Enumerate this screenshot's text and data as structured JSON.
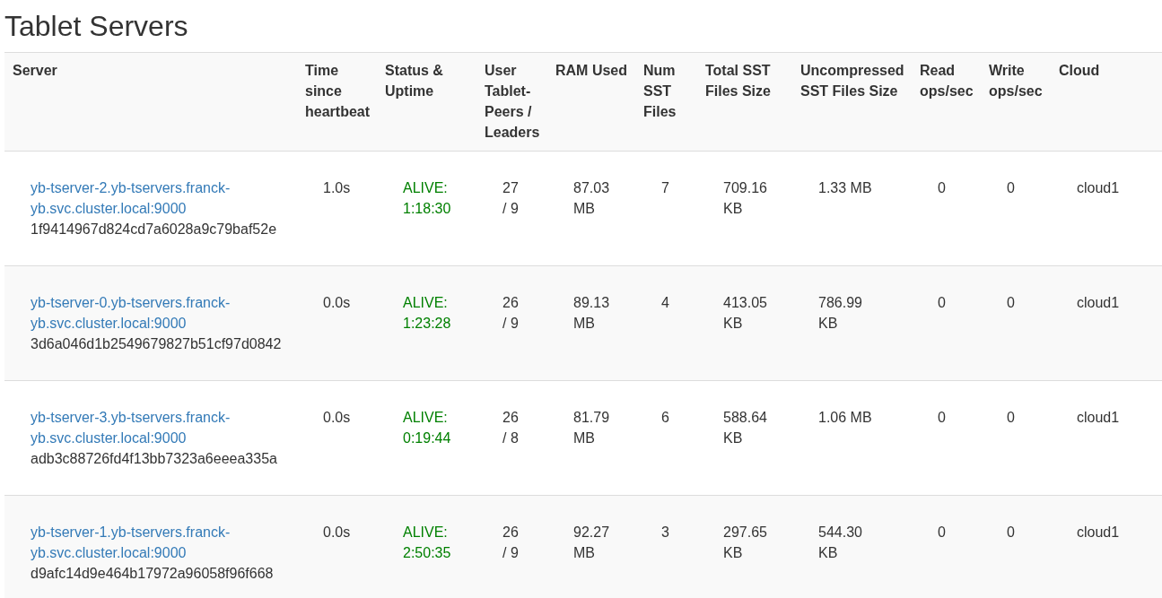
{
  "title": "Tablet Servers",
  "columns": [
    "Server",
    "Time since heartbeat",
    "Status & Uptime",
    "User Tablet-Peers / Leaders",
    "RAM Used",
    "Num SST Files",
    "Total SST Files Size",
    "Uncompressed SST Files Size",
    "Read ops/sec",
    "Write ops/sec",
    "Cloud"
  ],
  "rows": [
    {
      "server": "yb-tserver-2.yb-tservers.franck-yb.svc.cluster.local:9000",
      "uuid": "1f9414967d824cd7a6028a9c79baf52e",
      "heartbeat": "1.0s",
      "status": "ALIVE: 1:18:30",
      "alive": true,
      "peers": "27 / 9",
      "ram": "87.03 MB",
      "num_sst": "7",
      "total_sst": "709.16 KB",
      "uncompressed": "1.33 MB",
      "read": "0",
      "write": "0",
      "cloud": "cloud1"
    },
    {
      "server": "yb-tserver-0.yb-tservers.franck-yb.svc.cluster.local:9000",
      "uuid": "3d6a046d1b2549679827b51cf97d0842",
      "heartbeat": "0.0s",
      "status": "ALIVE: 1:23:28",
      "alive": true,
      "peers": "26 / 9",
      "ram": "89.13 MB",
      "num_sst": "4",
      "total_sst": "413.05 KB",
      "uncompressed": "786.99 KB",
      "read": "0",
      "write": "0",
      "cloud": "cloud1"
    },
    {
      "server": "yb-tserver-3.yb-tservers.franck-yb.svc.cluster.local:9000",
      "uuid": "adb3c88726fd4f13bb7323a6eeea335a",
      "heartbeat": "0.0s",
      "status": "ALIVE: 0:19:44",
      "alive": true,
      "peers": "26 / 8",
      "ram": "81.79 MB",
      "num_sst": "6",
      "total_sst": "588.64 KB",
      "uncompressed": "1.06 MB",
      "read": "0",
      "write": "0",
      "cloud": "cloud1"
    },
    {
      "server": "yb-tserver-1.yb-tservers.franck-yb.svc.cluster.local:9000",
      "uuid": "d9afc14d9e464b17972a96058f96f668",
      "heartbeat": "0.0s",
      "status": "ALIVE: 2:50:35",
      "alive": true,
      "peers": "26 / 9",
      "ram": "92.27 MB",
      "num_sst": "3",
      "total_sst": "297.65 KB",
      "uncompressed": "544.30 KB",
      "read": "0",
      "write": "0",
      "cloud": "cloud1"
    }
  ]
}
